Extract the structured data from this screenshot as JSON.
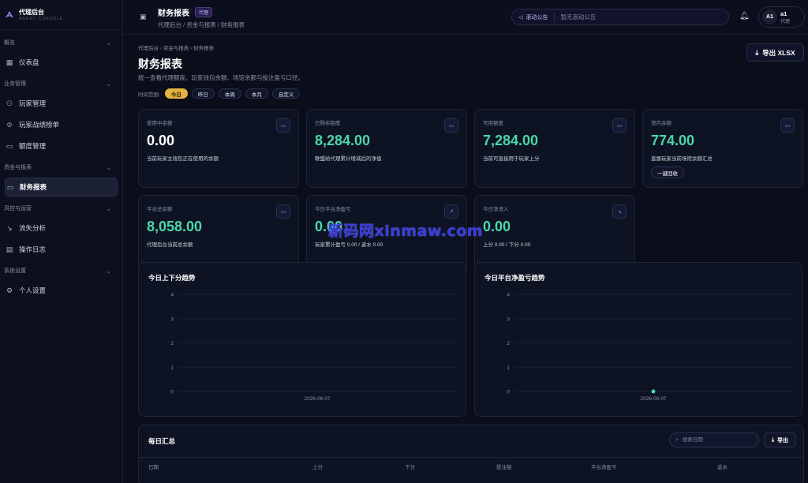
{
  "brand": {
    "title": "代理后台",
    "subtitle": "AGENT CONSOLE"
  },
  "sidebar": {
    "sections": [
      {
        "label": "概览",
        "items": [
          {
            "label": "仪表盘",
            "icon": "dashboard-icon"
          }
        ]
      },
      {
        "label": "业务管理",
        "items": [
          {
            "label": "玩家管理",
            "icon": "users-icon"
          },
          {
            "label": "玩家战绩榜单",
            "icon": "trophy-icon"
          },
          {
            "label": "额度管理",
            "icon": "wallet-icon"
          }
        ]
      },
      {
        "label": "资金与报表",
        "items": [
          {
            "label": "财务报表",
            "icon": "wallet-icon",
            "active": true
          }
        ]
      },
      {
        "label": "风控与运营",
        "items": [
          {
            "label": "流失分析",
            "icon": "trend-down-icon"
          },
          {
            "label": "操作日志",
            "icon": "clipboard-icon"
          }
        ]
      },
      {
        "label": "系统设置",
        "items": [
          {
            "label": "个人设置",
            "icon": "gear-icon"
          }
        ]
      }
    ]
  },
  "header": {
    "title": "财务报表",
    "badge": "代理",
    "breadcrumb": "代理后台 / 资金与报表 / 财务报表"
  },
  "announcement": {
    "label": "滚动公告",
    "text": "暂无滚动公告"
  },
  "user": {
    "avatar": "A1",
    "name": "a1",
    "role": "代理"
  },
  "page": {
    "breadcrumb": [
      "代理后台",
      "资金与报表",
      "财务报表"
    ],
    "title": "财务报表",
    "subtitle": "统一查看代理额度、玩家钱包余额、场馆余额与投注盈亏口径。",
    "export_label": "导出 XLSX",
    "range_label": "时间范围:",
    "ranges": [
      "今日",
      "昨日",
      "本周",
      "本月",
      "自定义"
    ],
    "active_range": "今日"
  },
  "cards": [
    {
      "label": "使用中余额",
      "value": "0.00",
      "desc": "当前玩家主钱包正在使用的余额",
      "color": "#ffffff",
      "icon": "wallet-icon"
    },
    {
      "label": "已购买额度",
      "value": "8,284.00",
      "desc": "联盟给代理累计增减后的净值",
      "color": "#4cd6a8",
      "icon": "wallet-icon"
    },
    {
      "label": "可用额度",
      "value": "7,284.00",
      "desc": "当前可直接用于玩家上分",
      "color": "#4cd6a8",
      "icon": "wallet-icon"
    },
    {
      "label": "馆内余额",
      "value": "774.00",
      "desc": "直属玩家当前场馆余额汇总",
      "color": "#4cd6a8",
      "icon": "wallet-icon",
      "action": "一键回收"
    },
    {
      "label": "平台总余额",
      "value": "8,058.00",
      "desc": "代理后台当前总余额",
      "color": "#4cd6a8",
      "icon": "wallet-icon"
    },
    {
      "label": "今日平台净盈亏",
      "value": "0.00",
      "desc": "玩家累计盈亏 0.00 / 返水 0.00",
      "color": "#4cd6a8",
      "icon": "trend-up-icon"
    },
    {
      "label": "今日净流入",
      "value": "0.00",
      "desc": "上分 0.00 / 下分 0.00",
      "color": "#4cd6a8",
      "icon": "trend-down-icon"
    }
  ],
  "charts": [
    {
      "title": "今日上下分趋势"
    },
    {
      "title": "今日平台净盈亏趋势"
    }
  ],
  "chart_data": [
    {
      "type": "line",
      "title": "今日上下分趋势",
      "x": [
        "2026-06-07"
      ],
      "series": [],
      "ylim": [
        0,
        4
      ],
      "yticks": [
        "0",
        "1",
        "2",
        "3",
        "4"
      ]
    },
    {
      "type": "line",
      "title": "今日平台净盈亏趋势",
      "x": [
        "2026-06-07"
      ],
      "series": [
        {
          "values": [
            0
          ]
        }
      ],
      "ylim": [
        0,
        4
      ],
      "yticks": [
        "0",
        "1",
        "2",
        "3",
        "4"
      ]
    }
  ],
  "table": {
    "title": "每日汇总",
    "search_placeholder": "搜索日期",
    "export_label": "导出",
    "columns": [
      "日期",
      "上分",
      "下分",
      "投注额",
      "平台净盈亏",
      "返水"
    ]
  },
  "watermark": "新码网xinmaw.com"
}
